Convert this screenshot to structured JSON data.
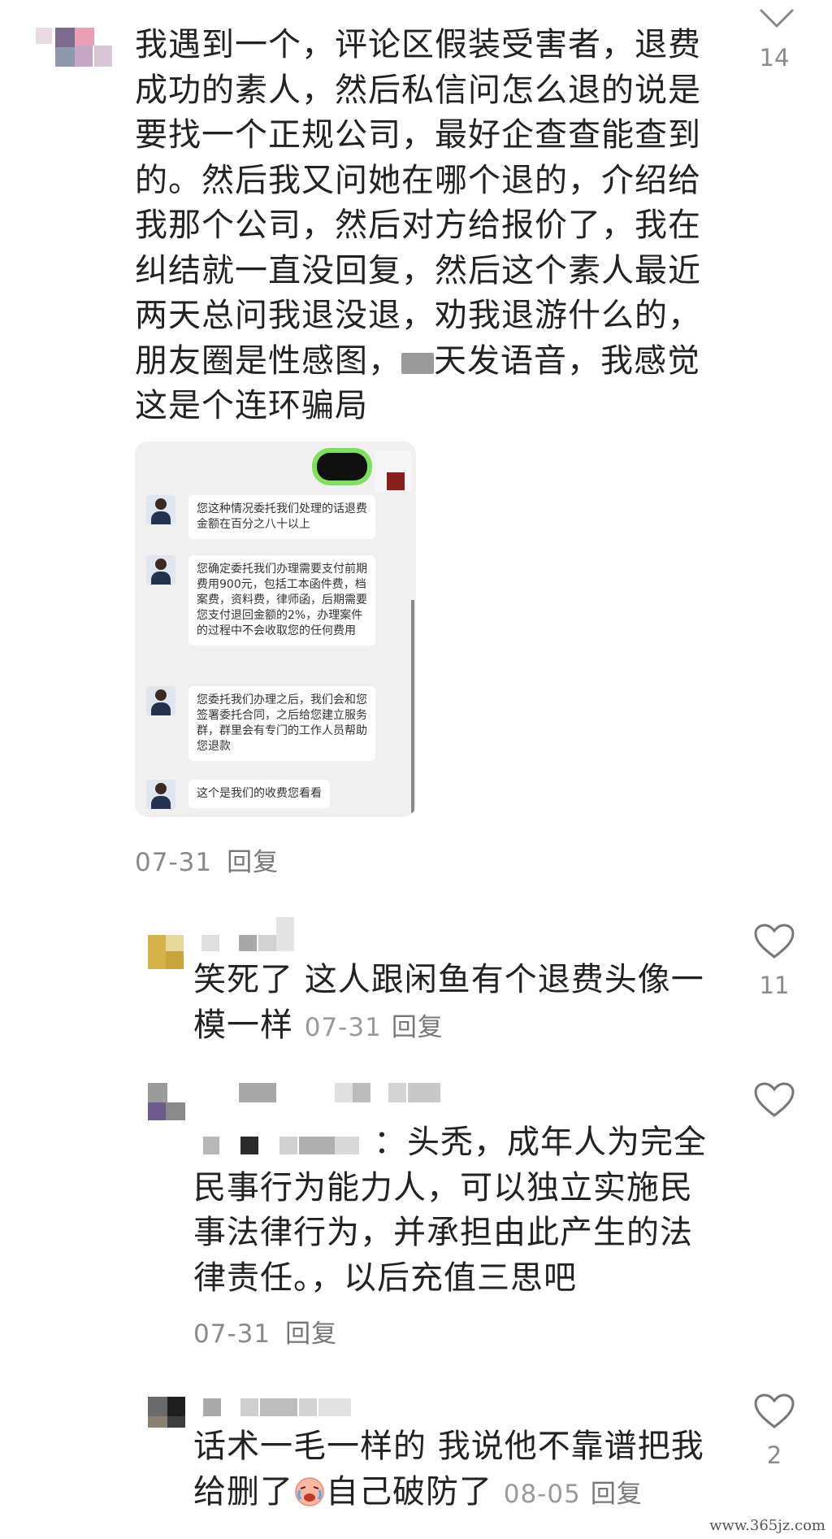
{
  "top_comment": {
    "text_lines": [
      "我遇到一个，评论区假装受害者，退费",
      "成功的素人，然后私信问怎么退的说是",
      "要找一个正规公司，最好企查查能查到",
      "的。然后我又问她在哪个退的，介绍给",
      "我那个公司，然后对方给报价了，我在",
      "纠结就一直没回复，然后这个素人最近",
      "两天总问我退没退，劝我退游什么的，"
    ],
    "line8_a": "朋友圈是性感图，",
    "line8_b": "天发语音，我感觉",
    "line9": "这是个连环骗局",
    "date": "07-31",
    "reply_label": "回复",
    "likes": "14"
  },
  "screenshot": {
    "messages": [
      "您这种情况委托我们处理的话退费金额在百分之八十以上",
      "您确定委托我们办理需要支付前期费用900元，包括工本函件费，档案费，资料费，律师函，后期需要您支付退回金额的2%，办理案件的过程中不会收取您的任何费用",
      "您委托我们办理之后，我们会和您签署委托合同，之后给您建立服务群，群里会有专门的工作人员帮助您退款",
      "这个是我们的收费您看看"
    ]
  },
  "replies": [
    {
      "text_lines": [
        "笑死了 这人跟闲鱼有个退费头像一",
        "模一样"
      ],
      "date": "07-31",
      "reply_label": "回复",
      "likes": "11"
    },
    {
      "prefix": "：头秃，成年人为完全",
      "text_lines": [
        "民事行为能力人，可以独立实施民",
        "事法律行为，并承担由此产生的法",
        "律责任。，以后充值三思吧"
      ],
      "date": "07-31",
      "reply_label": "回复",
      "likes": ""
    },
    {
      "text_lines": [
        "话术一毛一样的 我说他不靠谱把我"
      ],
      "line2_a": "给删了",
      "line2_b": "自己破防了",
      "date": "08-05",
      "reply_label": "回复",
      "likes": "2"
    }
  ],
  "watermark": "www.365jz.com",
  "icons": {
    "like": "heart-outline-icon",
    "collapse": "chevron-down-icon",
    "emoji": "crying-laughing-emoji-icon"
  },
  "colors": {
    "text": "#222222",
    "meta": "#8a8a8a",
    "highlight": "#7ee05e"
  }
}
